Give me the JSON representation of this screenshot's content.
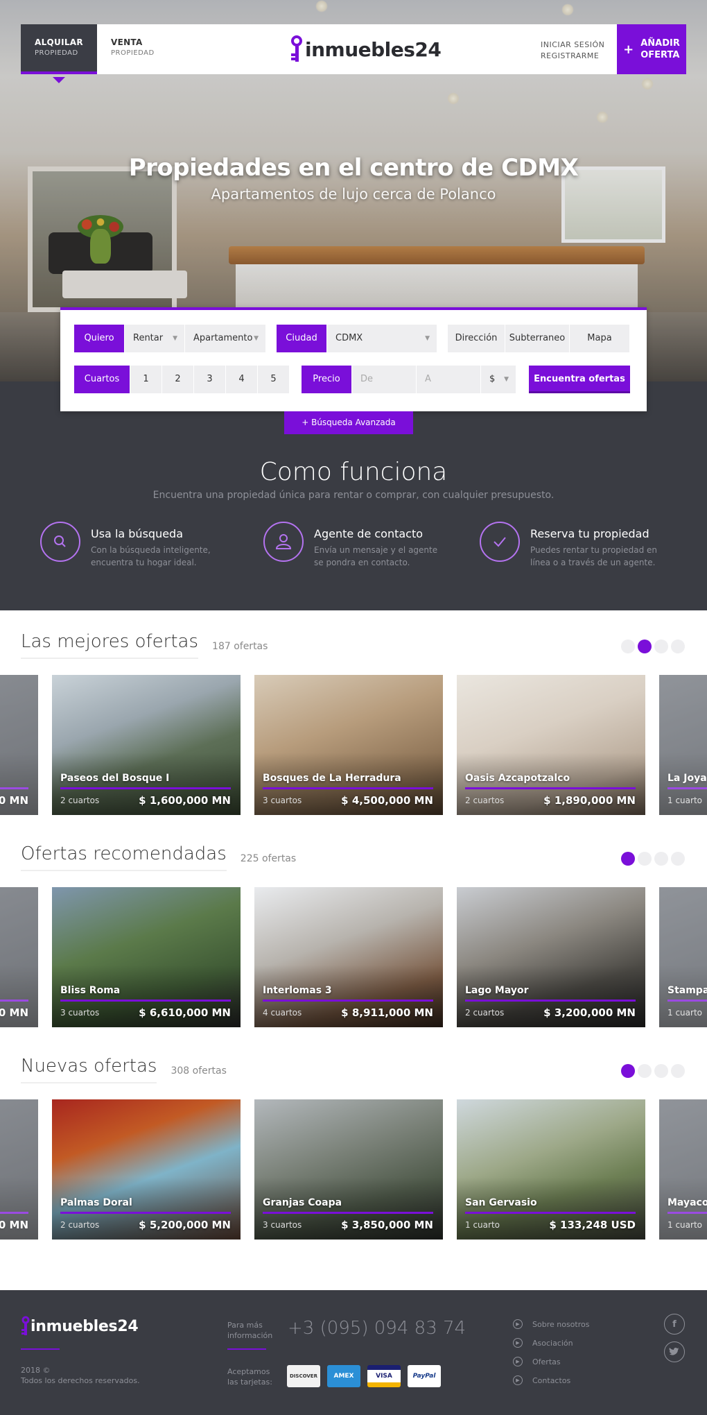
{
  "nav": {
    "rent_title": "ALQUILAR",
    "rent_sub": "PROPIEDAD",
    "sale_title": "VENTA",
    "sale_sub": "PROPIEDAD",
    "logo": "inmuebles24",
    "login": "INICIAR SESIÓN",
    "register": "REGISTRARME",
    "add_line1": "AÑADIR",
    "add_line2": "OFERTA"
  },
  "hero": {
    "title": "Propiedades en el centro de CDMX",
    "subtitle": "Apartamentos de lujo cerca de Polanco"
  },
  "search": {
    "want_label": "Quiero",
    "want_value": "Rentar",
    "type_value": "Apartamento",
    "city_label": "Ciudad",
    "city_value": "CDMX",
    "address": "Dirección",
    "subway": "Subterraneo",
    "map": "Mapa",
    "rooms_label": "Cuartos",
    "rooms": [
      "1",
      "2",
      "3",
      "4",
      "5"
    ],
    "price_label": "Precio",
    "from_placeholder": "De",
    "to_placeholder": "A",
    "currency": "$",
    "find_button": "Encuentra ofertas",
    "advanced": "+ Búsqueda Avanzada"
  },
  "how": {
    "title": "Como funciona",
    "subtitle": "Encuentra una propiedad única para rentar o comprar, con cualquier presupuesto.",
    "steps": [
      {
        "title": "Usa la búsqueda",
        "desc": "Con la búsqueda inteligente, encuentra tu hogar ideal.",
        "icon": "search-icon"
      },
      {
        "title": "Agente de contacto",
        "desc": "Envía un mensaje y el agente se pondra en contacto.",
        "icon": "user-icon"
      },
      {
        "title": "Reserva tu propiedad",
        "desc": "Puedes rentar tu propiedad en línea o a través de un agente.",
        "icon": "check-icon"
      }
    ]
  },
  "sections": [
    {
      "title": "Las mejores ofertas",
      "count": "187 ofertas",
      "active_dot": 1,
      "edge_left_price": "0 MN",
      "cards": [
        {
          "name": "Paseos del Bosque I",
          "rooms": "2 cuartos",
          "price": "$ 1,600,000 MN"
        },
        {
          "name": "Bosques de La Herradura",
          "rooms": "3 cuartos",
          "price": "$ 4,500,000 MN"
        },
        {
          "name": "Oasis Azcapotzalco",
          "rooms": "2 cuartos",
          "price": "$ 1,890,000 MN"
        }
      ],
      "edge_right_name": "La Joya",
      "edge_right_rooms": "1 cuarto"
    },
    {
      "title": "Ofertas recomendadas",
      "count": "225 ofertas",
      "active_dot": 0,
      "edge_left_price": "0 MN",
      "cards": [
        {
          "name": "Bliss Roma",
          "rooms": "3 cuartos",
          "price": "$ 6,610,000 MN"
        },
        {
          "name": "Interlomas 3",
          "rooms": "4 cuartos",
          "price": "$ 8,911,000 MN"
        },
        {
          "name": "Lago Mayor",
          "rooms": "2 cuartos",
          "price": "$ 3,200,000 MN"
        }
      ],
      "edge_right_name": "Stampa",
      "edge_right_rooms": "1 cuarto"
    },
    {
      "title": "Nuevas ofertas",
      "count": "308 ofertas",
      "active_dot": 0,
      "edge_left_price": "0 MN",
      "cards": [
        {
          "name": "Palmas Doral",
          "rooms": "2 cuartos",
          "price": "$ 5,200,000 MN"
        },
        {
          "name": "Granjas Coapa",
          "rooms": "3 cuartos",
          "price": "$ 3,850,000 MN"
        },
        {
          "name": "San Gervasio",
          "rooms": "1 cuarto",
          "price": "$ 133,248 USD"
        }
      ],
      "edge_right_name": "Mayacol",
      "edge_right_rooms": "1 cuarto"
    }
  ],
  "footer": {
    "logo": "inmuebles24",
    "copyright_year": "2018 ©",
    "copyright_text": "Todos los derechos reservados.",
    "info_label_1": "Para más",
    "info_label_2": "información",
    "phone": "+3 (095) 094 83 74",
    "cards_label_1": "Aceptamos",
    "cards_label_2": "las tarjetas:",
    "cards": [
      "DISCOVER",
      "AMEX",
      "VISA",
      "PayPal"
    ],
    "links": [
      "Sobre nosotros",
      "Asociación",
      "Ofertas",
      "Contactos"
    ],
    "social": [
      "facebook-icon",
      "twitter-icon"
    ]
  },
  "colors": {
    "accent": "#7a0fd9",
    "dark": "#3a3c43"
  }
}
